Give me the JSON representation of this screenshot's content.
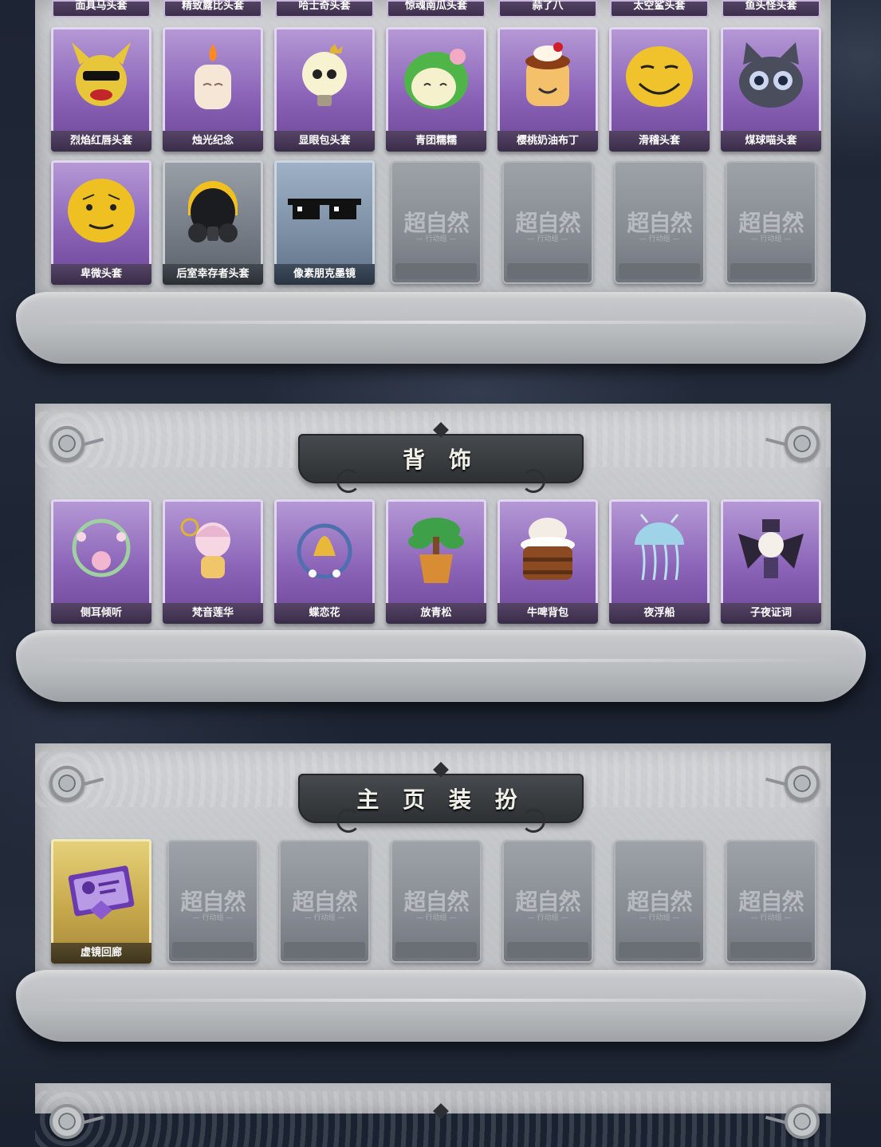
{
  "sections": {
    "headgear": {
      "top_row_labels": [
        "面具马头套",
        "精致露比头套",
        "哈士奇头套",
        "惊魂南瓜头套",
        "蒜了八",
        "太空鲨头套",
        "鱼头怪头套"
      ],
      "row1": [
        "烈焰红唇头套",
        "烛光纪念",
        "显眼包头套",
        "青团糯糯",
        "樱桃奶油布丁",
        "滑稽头套",
        "煤球喵头套"
      ],
      "row2": [
        "卑微头套",
        "后室幸存者头套",
        "像素朋克墨镜"
      ]
    },
    "back_accessories": {
      "title": "背 饰",
      "items": [
        "侧耳倾听",
        "梵音莲华",
        "蝶恋花",
        "放青松",
        "牛啤背包",
        "夜浮船",
        "子夜证词"
      ]
    },
    "profile_decor": {
      "title": "主 页 装 扮",
      "items": [
        "虚镜回廊"
      ]
    }
  },
  "placeholder": {
    "title": "超自然",
    "subtitle": "— 行动组 —"
  }
}
